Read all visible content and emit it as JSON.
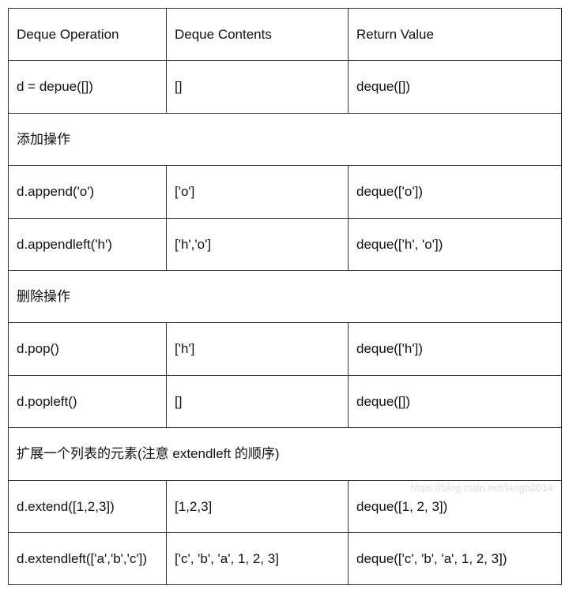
{
  "chart_data": {
    "type": "table",
    "headers": [
      "Deque Operation",
      "Deque Contents",
      "Return Value"
    ],
    "rows": [
      {
        "op": "d = depue([])",
        "contents": "[]",
        "ret": "deque([])"
      },
      {
        "section": "添加操作"
      },
      {
        "op": "d.append('o')",
        "contents": "['o']",
        "ret": "deque(['o'])"
      },
      {
        "op": "d.appendleft('h')",
        "contents": "['h','o']",
        "ret": "deque(['h', 'o'])"
      },
      {
        "section": "删除操作"
      },
      {
        "op": "d.pop()",
        "contents": "['h']",
        "ret": "deque(['h'])"
      },
      {
        "op": "d.popleft()",
        "contents": "[]",
        "ret": "deque([])"
      },
      {
        "section": "扩展一个列表的元素(注意 extendleft 的顺序)"
      },
      {
        "op": "d.extend([1,2,3])",
        "contents": "[1,2,3]",
        "ret": "deque([1, 2, 3])"
      },
      {
        "op": "d.extendleft(['a','b','c'])",
        "contents": "['c', 'b', 'a', 1, 2, 3]",
        "ret": "deque(['c', 'b', 'a', 1, 2, 3])"
      }
    ]
  },
  "watermark": "https://blog.csdn.net/langb2014"
}
